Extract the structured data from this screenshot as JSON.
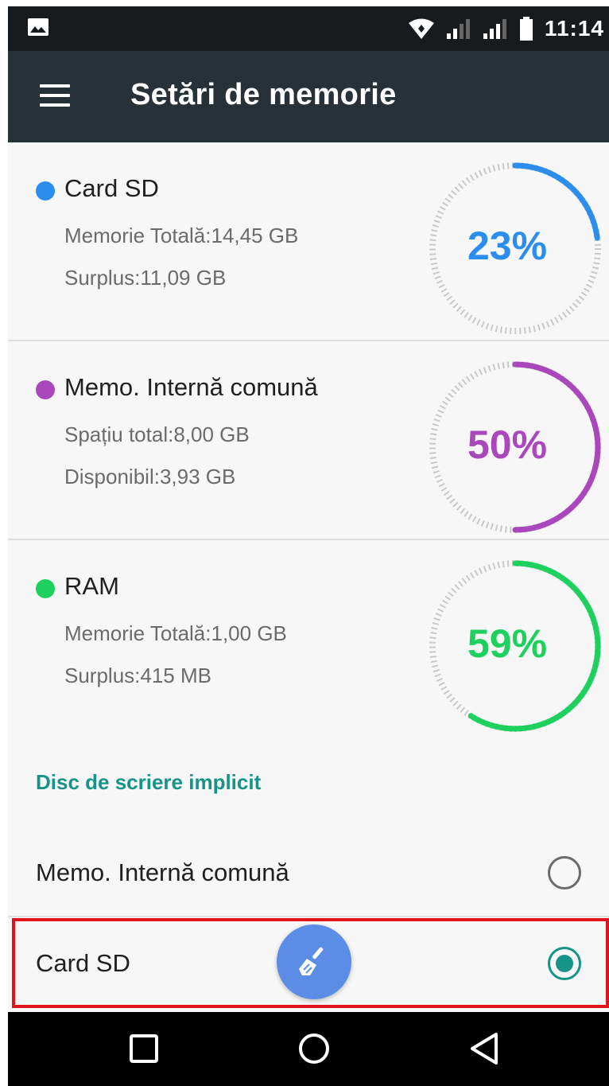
{
  "status_bar": {
    "time": "11:14",
    "icons": [
      "image-notification-icon",
      "wifi-icon",
      "signal-icon",
      "signal-icon",
      "battery-icon"
    ]
  },
  "app_bar": {
    "menu_icon": "menu-icon",
    "title": "Setări de memorie"
  },
  "storage": [
    {
      "name": "Card SD",
      "line1": "Memorie Totală:14,45 GB",
      "line2": "Surplus:11,09 GB",
      "percent_label": "23%",
      "percent": 23,
      "color": "#2b8ded"
    },
    {
      "name": "Memo. Internă comună",
      "line1": "Spațiu total:8,00 GB",
      "line2": "Disponibil:3,93 GB",
      "percent_label": "50%",
      "percent": 50,
      "color": "#ab47bc"
    },
    {
      "name": "RAM",
      "line1": "Memorie Totală:1,00 GB",
      "line2": "Surplus:415 MB",
      "percent_label": "59%",
      "percent": 59,
      "color": "#1ed05e"
    }
  ],
  "default_disk": {
    "header": "Disc de scriere implicit",
    "options": [
      {
        "label": "Memo. Internă comună",
        "selected": false
      },
      {
        "label": "Card SD",
        "selected": true
      }
    ]
  },
  "fab": {
    "icon": "broom-icon"
  },
  "nav_bar": {
    "icons": [
      "recent-apps-icon",
      "home-icon",
      "back-icon"
    ]
  },
  "colors": {
    "accent": "#159487",
    "app_bar": "#263238",
    "status_bar": "#171b1e",
    "highlight": "#e0141c",
    "fab": "#5b8de6"
  }
}
